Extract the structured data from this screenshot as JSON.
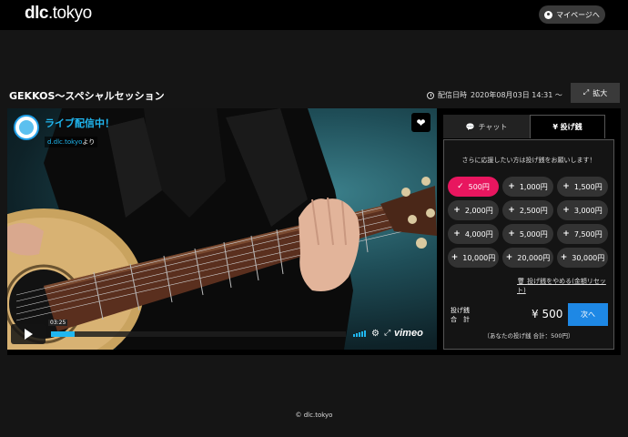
{
  "header": {
    "logo_bold": "dlc",
    "logo_rest": ".tokyo",
    "mypage_label": "マイページへ"
  },
  "page": {
    "title": "GEKKOS～スペシャルセッション",
    "datetime_label": "配信日時",
    "datetime_value": "2020年08月03日 14:31 〜",
    "expand_label": "拡大"
  },
  "video": {
    "live_title": "ライブ配信中！",
    "live_sub_link": "d.dlc.tokyo",
    "live_sub_suffix": "より",
    "current_time": "03:25",
    "progress_fraction": 0.08,
    "provider": "vimeo"
  },
  "panel": {
    "tab_chat": "チャット",
    "tab_tip": "¥ 投げ銭",
    "message": "さらに応援したい方は投げ銭をお願いします！",
    "amounts": [
      "500円",
      "1,000円",
      "1,500円",
      "2,000円",
      "2,500円",
      "3,000円",
      "4,000円",
      "5,000円",
      "7,500円",
      "10,000円",
      "20,000円",
      "30,000円"
    ],
    "selected_amount": "500円",
    "cancel_label": "投げ銭をやめる(金額リセット)",
    "sum_label_1": "投げ銭",
    "sum_label_2": "合　計",
    "sum_value": "¥ 500",
    "next_label": "次へ",
    "sum_note": "（あなたの投げ銭 合計：500円）"
  },
  "footer": {
    "copyright": "© dlc.tokyo"
  },
  "colors": {
    "accent_blue": "#1e88e5",
    "selected_pink": "#e8165f",
    "live_blue": "#20b7f0"
  }
}
